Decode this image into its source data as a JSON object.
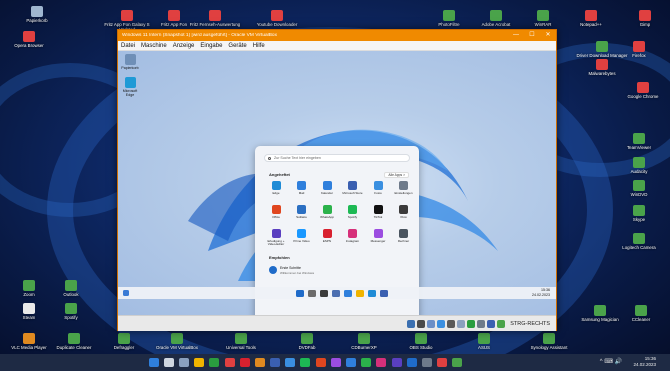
{
  "host_desktop": {
    "icons": [
      {
        "label": "Papierkorb",
        "color": "#9fb6d0",
        "icon": "recycle-bin-icon"
      },
      {
        "label": "Fritz App Fon Galaxy S Updated",
        "color": "#e04040",
        "icon": "file-icon"
      },
      {
        "label": "Fritz App Fon",
        "color": "#e04040",
        "icon": "file-icon"
      },
      {
        "label": "Fritz Fernseh-Auswertung",
        "color": "#e04040",
        "icon": "file-icon"
      },
      {
        "label": "Youtube Downloader",
        "color": "#e04040",
        "icon": "app-icon"
      },
      {
        "label": "PhotoFiltre",
        "color": "#4aa34a",
        "icon": "app-icon"
      },
      {
        "label": "Adobe Acrobat",
        "color": "#4aa34a",
        "icon": "app-icon"
      },
      {
        "label": "WinRAR",
        "color": "#4aa34a",
        "icon": "app-icon"
      },
      {
        "label": "Notepad++",
        "color": "#e04040",
        "icon": "app-icon"
      },
      {
        "label": "Gimp",
        "color": "#e04040",
        "icon": "app-icon"
      },
      {
        "label": "Opera Browser",
        "color": "#e04040",
        "icon": "app-icon"
      },
      {
        "label": "Driver Download Manager",
        "color": "#4aa34a",
        "icon": "app-icon"
      },
      {
        "label": "Firefox",
        "color": "#e04040",
        "icon": "app-icon"
      },
      {
        "label": "Malwarebytes",
        "color": "#e04040",
        "icon": "app-icon"
      },
      {
        "label": "Google Chrome",
        "color": "#e04040",
        "icon": "app-icon"
      },
      {
        "label": "TeamViewer",
        "color": "#4aa34a",
        "icon": "app-icon"
      },
      {
        "label": "Audacity",
        "color": "#4aa34a",
        "icon": "app-icon"
      },
      {
        "label": "WinDVD",
        "color": "#4aa34a",
        "icon": "app-icon"
      },
      {
        "label": "Skype",
        "color": "#4aa34a",
        "icon": "app-icon"
      },
      {
        "label": "Logitech Camera",
        "color": "#4aa34a",
        "icon": "app-icon"
      },
      {
        "label": "Zoom",
        "color": "#4aa34a",
        "icon": "app-icon"
      },
      {
        "label": "Outlook",
        "color": "#4aa34a",
        "icon": "app-icon"
      },
      {
        "label": "Steam",
        "color": "#eaeaea",
        "icon": "app-icon"
      },
      {
        "label": "Spotify",
        "color": "#4aa34a",
        "icon": "app-icon"
      },
      {
        "label": "Samsung Magician",
        "color": "#4aa34a",
        "icon": "app-icon"
      },
      {
        "label": "CCleaner",
        "color": "#4aa34a",
        "icon": "app-icon"
      },
      {
        "label": "VLC Media Player",
        "color": "#e08a20",
        "icon": "app-icon"
      },
      {
        "label": "Duplicate Cleaner",
        "color": "#4aa34a",
        "icon": "app-icon"
      },
      {
        "label": "Defraggler",
        "color": "#4aa34a",
        "icon": "app-icon"
      },
      {
        "label": "Oracle VM VirtualBox",
        "color": "#4aa34a",
        "icon": "app-icon"
      },
      {
        "label": "Universal Tools",
        "color": "#4aa34a",
        "icon": "app-icon"
      },
      {
        "label": "DVDFab",
        "color": "#4aa34a",
        "icon": "app-icon"
      },
      {
        "label": "CDBurnerXP",
        "color": "#4aa34a",
        "icon": "app-icon"
      },
      {
        "label": "OBS Studio",
        "color": "#4aa34a",
        "icon": "app-icon"
      },
      {
        "label": "ASUS",
        "color": "#4aa34a",
        "icon": "app-icon"
      },
      {
        "label": "Synology Assistant",
        "color": "#4aa34a",
        "icon": "app-icon"
      }
    ]
  },
  "vm_window": {
    "title": "Windows 11 Intern (Snapshot 1) [wird ausgeführt] - Oracle VM VirtualBox",
    "minimize": "—",
    "maximize": "☐",
    "close": "✕",
    "menu": [
      "Datei",
      "Maschine",
      "Anzeige",
      "Eingabe",
      "Geräte",
      "Hilfe"
    ],
    "status_key": "STRG-RECHTS"
  },
  "guest_desktop": {
    "icons": [
      {
        "label": "Papierkorb",
        "color": "#6f8fb7",
        "icon": "recycle-bin-icon"
      },
      {
        "label": "Microsoft Edge",
        "color": "#1f9ad6",
        "icon": "edge-icon"
      }
    ]
  },
  "start_menu": {
    "search_placeholder": "Zur Suche Text hier eingeben",
    "pinned_heading": "Angeheftet",
    "all_apps": "Alle Apps  >",
    "pinned": [
      {
        "label": "Edge",
        "color": "#1f8bd6",
        "icon": "edge-icon"
      },
      {
        "label": "Mail",
        "color": "#2f7fdc",
        "icon": "mail-icon"
      },
      {
        "label": "Kalender",
        "color": "#2f7fdc",
        "icon": "calendar-icon"
      },
      {
        "label": "Microsoft Store",
        "color": "#3a5fb0",
        "icon": "store-icon"
      },
      {
        "label": "Fotos",
        "color": "#3a8fe0",
        "icon": "photos-icon"
      },
      {
        "label": "Einstellungen",
        "color": "#6e7a8a",
        "icon": "settings-icon"
      },
      {
        "label": "Office",
        "color": "#e0461f",
        "icon": "office-icon"
      },
      {
        "label": "Solitaire",
        "color": "#2b6fc2",
        "icon": "cards-icon"
      },
      {
        "label": "WhatsApp",
        "color": "#2bb24b",
        "icon": "whatsapp-icon"
      },
      {
        "label": "Spotify",
        "color": "#1db954",
        "icon": "spotify-icon"
      },
      {
        "label": "TikTok",
        "color": "#111111",
        "icon": "tiktok-icon"
      },
      {
        "label": "Xbox",
        "color": "#3b3b3b",
        "icon": "xbox-icon"
      },
      {
        "label": "Erledigung + Video-Editor",
        "color": "#5a3fc0",
        "icon": "clipchamp-icon"
      },
      {
        "label": "Prime Video",
        "color": "#1a98ff",
        "icon": "video-icon"
      },
      {
        "label": "ESPN",
        "color": "#d8212f",
        "icon": "espn-icon"
      },
      {
        "label": "Instagram",
        "color": "#d6307a",
        "icon": "instagram-icon"
      },
      {
        "label": "Messenger",
        "color": "#9b4de0",
        "icon": "messenger-icon"
      },
      {
        "label": "Rechner",
        "color": "#4a5560",
        "icon": "calculator-icon"
      }
    ],
    "recommended_heading": "Empfohlen",
    "recommended": {
      "title": "Erste Schritte",
      "subtitle": "Willkommen bei Windows"
    },
    "user": "andy",
    "power": "⏻"
  },
  "guest_taskbar": {
    "apps": [
      {
        "color": "#1f6bc9",
        "icon": "windows-start-icon"
      },
      {
        "color": "#6b6b6b",
        "icon": "search-icon"
      },
      {
        "color": "#3b3b3b",
        "icon": "task-view-icon"
      },
      {
        "color": "#4b6eb0",
        "icon": "widgets-icon"
      },
      {
        "color": "#2f7fdc",
        "icon": "chat-icon"
      },
      {
        "color": "#f0b400",
        "icon": "explorer-icon"
      },
      {
        "color": "#1f8bd6",
        "icon": "edge-icon"
      },
      {
        "color": "#3a5fb0",
        "icon": "store-icon"
      }
    ],
    "time": "15:36",
    "date": "24.02.2023"
  },
  "host_taskbar": {
    "apps": [
      {
        "color": "#2f7fdc",
        "icon": "windows-start-icon"
      },
      {
        "color": "#cfd6e0",
        "icon": "search-icon"
      },
      {
        "color": "#8aa0bf",
        "icon": "task-view-icon"
      },
      {
        "color": "#f0b400",
        "icon": "explorer-icon"
      },
      {
        "color": "#2a9d3f",
        "icon": "app-icon"
      },
      {
        "color": "#e04040",
        "icon": "app-icon"
      },
      {
        "color": "#d8212f",
        "icon": "app-icon"
      },
      {
        "color": "#e08a20",
        "icon": "app-icon"
      },
      {
        "color": "#3a5fb0",
        "icon": "app-icon"
      },
      {
        "color": "#3a8fe0",
        "icon": "app-icon"
      },
      {
        "color": "#1db954",
        "icon": "app-icon"
      },
      {
        "color": "#e0461f",
        "icon": "app-icon"
      },
      {
        "color": "#9b4de0",
        "icon": "app-icon"
      },
      {
        "color": "#2f7fdc",
        "icon": "app-icon"
      },
      {
        "color": "#2bb24b",
        "icon": "app-icon"
      },
      {
        "color": "#d6307a",
        "icon": "app-icon"
      },
      {
        "color": "#5a3fc0",
        "icon": "app-icon"
      },
      {
        "color": "#1f6bc9",
        "icon": "app-icon"
      },
      {
        "color": "#6e7a8a",
        "icon": "app-icon"
      },
      {
        "color": "#e04040",
        "icon": "app-icon"
      },
      {
        "color": "#4aa34a",
        "icon": "app-icon"
      }
    ],
    "tray": "^  ⌨  🔊",
    "time": "15:36",
    "date": "24.02.2023"
  }
}
